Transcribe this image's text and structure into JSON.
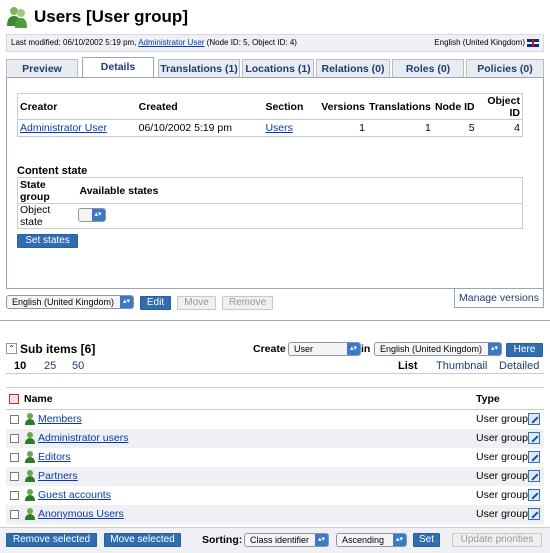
{
  "header": {
    "title": "Users [User group]"
  },
  "modbar": {
    "prefix": "Last modified: 06/10/2002 5:19 pm, ",
    "author": "Administrator User",
    "suffix": " (Node ID: 5, Object ID: 4)",
    "language": "English (United Kingdom)"
  },
  "tabs": [
    "Preview",
    "Details",
    "Translations (1)",
    "Locations (1)",
    "Relations (0)",
    "Roles (0)",
    "Policies (0)"
  ],
  "details": {
    "headers": [
      "Creator",
      "Created",
      "Section",
      "Versions",
      "Translations",
      "Node ID",
      "Object ID"
    ],
    "row": [
      "Administrator User",
      "06/10/2002 5:19 pm",
      "Users",
      "1",
      "1",
      "5",
      "4"
    ]
  },
  "content_state": {
    "title": "Content state",
    "headers": [
      "State group",
      "Available states"
    ],
    "row_label": "Object state",
    "set_states_label": "Set states"
  },
  "edit_bar": {
    "language_select": "English (United Kingdom)",
    "edit": "Edit",
    "move": "Move",
    "remove": "Remove",
    "manage_versions": "Manage versions"
  },
  "subitems": {
    "title": "Sub items [6]",
    "create_label": "Create",
    "create_class": "User",
    "in_label": "in",
    "in_language": "English (United Kingdom)",
    "here": "Here",
    "limits": [
      "10",
      "25",
      "50"
    ],
    "views": [
      "List",
      "Thumbnail",
      "Detailed"
    ],
    "col_name": "Name",
    "col_type": "Type",
    "rows": [
      {
        "name": "Members",
        "type": "User group"
      },
      {
        "name": "Administrator users",
        "type": "User group"
      },
      {
        "name": "Editors",
        "type": "User group"
      },
      {
        "name": "Partners",
        "type": "User group"
      },
      {
        "name": "Guest accounts",
        "type": "User group"
      },
      {
        "name": "Anonymous Users",
        "type": "User group"
      }
    ]
  },
  "bottom": {
    "remove_selected": "Remove selected",
    "move_selected": "Move selected",
    "sorting_label": "Sorting:",
    "sort_field": "Class identifier",
    "sort_order": "Ascending",
    "set": "Set",
    "update_priorities": "Update priorities"
  },
  "colors": {
    "accent": "#2f6cb0",
    "link": "#0b3aa8",
    "tab_text": "#1c3d6e"
  }
}
